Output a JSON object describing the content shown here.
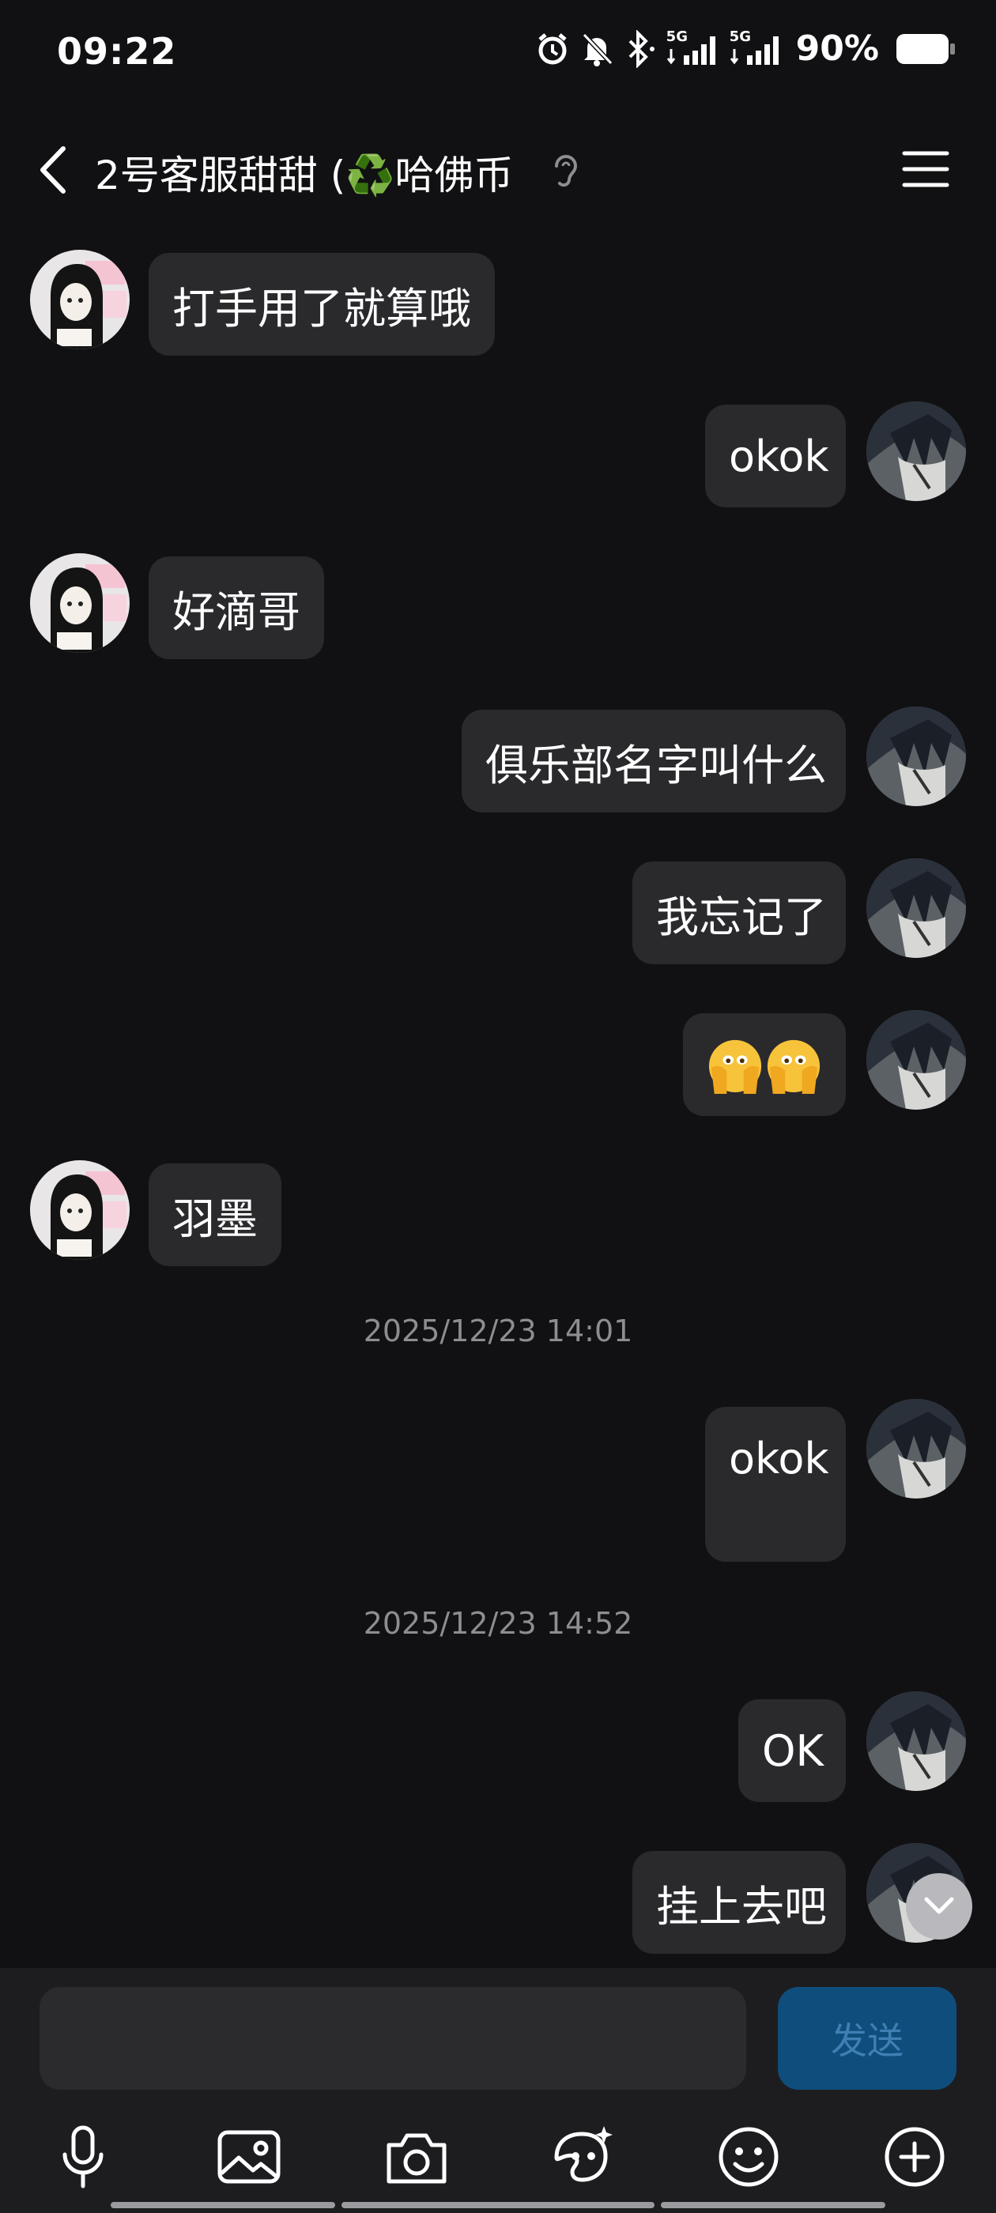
{
  "status_bar": {
    "time": "09:22",
    "network_1": "5G",
    "network_2": "5G",
    "battery": "90%"
  },
  "header": {
    "title": "2号客服甜甜 (♻️哈佛币",
    "icons": [
      "back-arrow-icon",
      "ear-icon",
      "menu-icon"
    ]
  },
  "messages": [
    {
      "side": "left",
      "text": "打手用了就算哦"
    },
    {
      "side": "right",
      "text": "okok"
    },
    {
      "side": "left",
      "text": "好滴哥"
    },
    {
      "side": "right",
      "text": "俱乐部名字叫什么"
    },
    {
      "side": "right",
      "text": "我忘记了"
    },
    {
      "side": "right",
      "text": "🫣🫣"
    },
    {
      "side": "left",
      "text": "羽墨"
    },
    {
      "side": "timestamp",
      "text": "2025/12/23 14:01"
    },
    {
      "side": "right",
      "text": "okok"
    },
    {
      "side": "timestamp",
      "text": "2025/12/23 14:52"
    },
    {
      "side": "right",
      "text": "OK"
    },
    {
      "side": "right",
      "text": "挂上去吧"
    }
  ],
  "input": {
    "value": "",
    "send_label": "发送"
  },
  "toolbar": [
    "microphone-icon",
    "image-icon",
    "camera-icon",
    "sticker-icon",
    "emoji-icon",
    "plus-icon"
  ]
}
